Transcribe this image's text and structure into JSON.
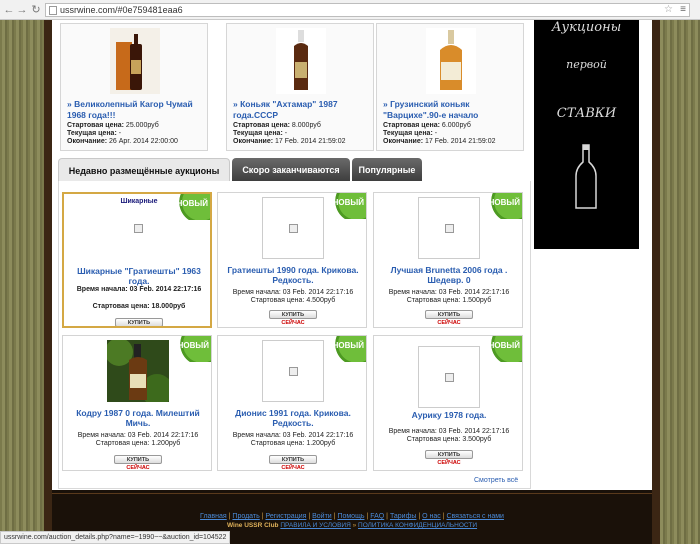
{
  "browser": {
    "url": "ussrwine.com/#0e759481eaa6",
    "status_url": "ussrwine.com/auction_details.php?name=~1990~~&auction_id=104522"
  },
  "top_auctions": [
    {
      "title": "» Великолепный Кагор Чумай 1968 года!!!",
      "start_label": "Стартовая цена:",
      "start_value": "25.000руб",
      "current_label": "Текущая цена:",
      "current_value": "-",
      "end_label": "Окончание:",
      "end_value": "26 Apr. 2014 22:00:00"
    },
    {
      "title": "» Коньяк \"Ахтамар\" 1987 года.СССР",
      "start_label": "Стартовая цена:",
      "start_value": "8.000руб",
      "current_label": "Текущая цена:",
      "current_value": "-",
      "end_label": "Окончание:",
      "end_value": "17 Feb. 2014 21:59:02"
    },
    {
      "title": "» Грузинский коньяк \"Варцихе\".90-е начало",
      "start_label": "Стартовая цена:",
      "start_value": "6.000руб",
      "current_label": "Текущая цена:",
      "current_value": "-",
      "end_label": "Окончание:",
      "end_value": "17 Feb. 2014 21:59:02"
    }
  ],
  "ad": {
    "line1": "Аукционы",
    "line2": "первой",
    "line3": "СТАВКИ"
  },
  "tabs": [
    {
      "label": "Недавно размещённые аукционы"
    },
    {
      "label": "Скоро заканчиваются"
    },
    {
      "label": "Популярные"
    }
  ],
  "badge_label": "НОВЫЙ",
  "buy_label_a": "КУПИТЬ",
  "buy_label_b": "СЕЙЧАС",
  "listings": [
    {
      "image_caption": "Шикарные",
      "title": "Шикарные \"Гратиешты\" 1963 года.",
      "time_label": "Время начала:",
      "time_value": "03 Feb. 2014 22:17:16",
      "price_label": "Стартовая цена:",
      "price_value": "18.000руб"
    },
    {
      "title": "Гратиешты 1990 года. Крикова. Редкость.",
      "time_label": "Время начала:",
      "time_value": "03 Feb. 2014 22:17:16",
      "price_label": "Стартовая цена:",
      "price_value": "4.500руб"
    },
    {
      "title": "Лучшая Brunetta 2006 года . Шедевр. 0",
      "time_label": "Время начала:",
      "time_value": "03 Feb. 2014 22:17:16",
      "price_label": "Стартовая цена:",
      "price_value": "1.500руб"
    },
    {
      "title": "Кодру 1987 0 года. Милештий Мичь.",
      "time_label": "Время начала:",
      "time_value": "03 Feb. 2014 22:17:16",
      "price_label": "Стартовая цена:",
      "price_value": "1.200руб"
    },
    {
      "title": "Дионис 1991 года. Крикова. Редкость.",
      "time_label": "Время начала:",
      "time_value": "03 Feb. 2014 22:17:16",
      "price_label": "Стартовая цена:",
      "price_value": "1.200руб"
    },
    {
      "title": "Аурику 1978 года.",
      "time_label": "Время начала:",
      "time_value": "03 Feb. 2014 22:17:16",
      "price_label": "Стартовая цена:",
      "price_value": "3.500руб"
    }
  ],
  "see_all": "Смотреть всё",
  "footer": {
    "links": [
      "Главная",
      "Продать",
      "Регистрация",
      "Войти",
      "Помощь",
      "FAQ",
      "Тарифы",
      "О нас",
      "Связаться с нами"
    ],
    "brand": "Wine USSR Club",
    "rules": "ПРАВИЛА И УСЛОВИЯ",
    "privacy": "ПОЛИТИКА КОНФИДЕНЦИАЛЬНОСТИ"
  }
}
